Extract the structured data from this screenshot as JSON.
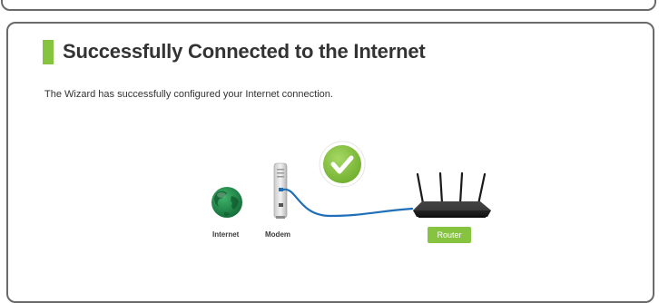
{
  "page": {
    "title": "Successfully Connected to the Internet",
    "description": "The Wizard has successfully configured your Internet connection."
  },
  "diagram": {
    "internet_label": "Internet",
    "modem_label": "Modem",
    "router_label": "Router",
    "status_icon": "check-icon",
    "colors": {
      "accent": "#86c440",
      "globe": "#1e8a4a",
      "cable": "#1f6fb8",
      "check": "#8cc63f"
    }
  }
}
